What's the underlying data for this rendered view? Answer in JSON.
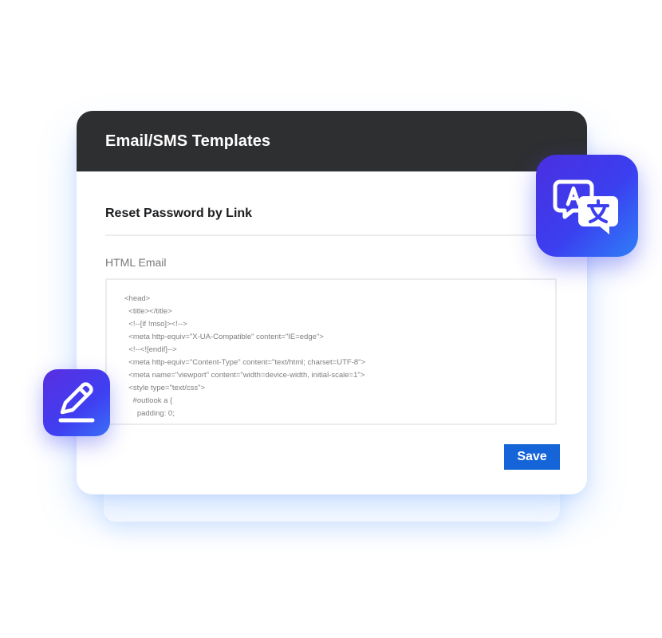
{
  "panel": {
    "title": "Email/SMS Templates",
    "template_name": "Reset Password by Link",
    "field_label": "HTML Email",
    "code_lines": [
      "<head>",
      "  <title></title>",
      "  <!--[if !mso]><!-->",
      "  <meta http-equiv=\"X-UA-Compatible\" content=\"IE=edge\">",
      "  <!--<![endif]-->",
      "  <meta http-equiv=\"Content-Type\" content=\"text/html; charset=UTF-8\">",
      "  <meta name=\"viewport\" content=\"width=device-width, initial-scale=1\">",
      "  <style type=\"text/css\">",
      "    #outlook a {",
      "      padding: 0;"
    ],
    "save_label": "Save"
  },
  "icons": {
    "translate": "translate-icon",
    "edit": "pencil-icon"
  },
  "colors": {
    "header_bg": "#2e2f31",
    "save_button": "#1565d8",
    "badge_gradient_start": "#4a2fe0",
    "badge_gradient_end": "#2f7ff8"
  }
}
